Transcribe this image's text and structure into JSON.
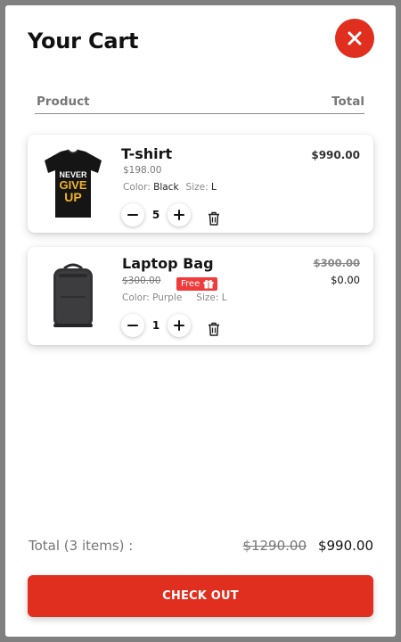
{
  "cart": {
    "title": "Your Cart",
    "close_icon": "close-icon",
    "accent_color": "#e02f1f"
  },
  "table_header": {
    "product": "Product",
    "total": "Total"
  },
  "items": [
    {
      "name": "T-shirt",
      "unit_price": "$198.00",
      "color_label": "Color:",
      "color_value": "Black",
      "size_label": "Size:",
      "size_value": "L",
      "quantity": "5",
      "line_total": "$990.00",
      "image": "tshirt-image",
      "shirt_print": [
        "NEVER",
        "GIVE",
        "UP"
      ]
    },
    {
      "name": "Laptop Bag",
      "unit_price": "$300.00",
      "badge": "Free",
      "badge_icon": "gift-icon",
      "color_label": "Color:",
      "color_value": "Purple",
      "size_label": "Size:",
      "size_value": "L",
      "quantity": "1",
      "line_total_original": "$300.00",
      "line_total": "$0.00",
      "image": "backpack-image"
    }
  ],
  "summary": {
    "label": "Total (3 items) :",
    "original_total": "$1290.00",
    "total": "$990.00"
  },
  "checkout": {
    "label": "CHECK OUT"
  }
}
